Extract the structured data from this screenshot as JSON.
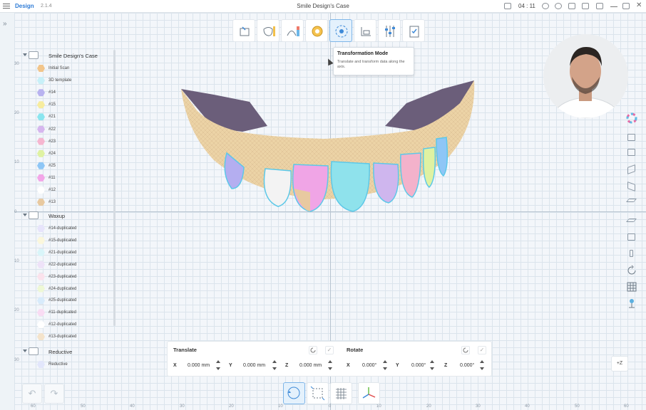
{
  "app": {
    "name": "Design",
    "superscript": "m",
    "version": "2.1.4",
    "doc_title": "Smile Design's Case",
    "recording_time": "04 : 11"
  },
  "toolbar": {
    "tools": [
      {
        "name": "prepare-tool",
        "active": false
      },
      {
        "name": "teeth-library-tool",
        "active": false
      },
      {
        "name": "adapt-tool",
        "active": false
      },
      {
        "name": "design-tool",
        "active": false
      },
      {
        "name": "transformation-mode-tool",
        "active": true
      },
      {
        "name": "base-tool",
        "active": false
      },
      {
        "name": "adjust-tool",
        "active": false
      },
      {
        "name": "finish-tool",
        "active": false
      }
    ]
  },
  "tooltip": {
    "title": "Transformation Mode",
    "description": "Translate and transform data along the axis."
  },
  "tree": {
    "groups": [
      {
        "label": "Smile Design's Case"
      },
      {
        "label": "Waxup"
      },
      {
        "label": "Reductive"
      }
    ],
    "case_items": [
      {
        "label": "Initial Scan",
        "color": "#f2c58a"
      },
      {
        "label": "3D template",
        "color": "#c8f0f8"
      },
      {
        "label": "#14",
        "color": "#b9b3f0"
      },
      {
        "label": "#15",
        "color": "#f7ec9e"
      },
      {
        "label": "#21",
        "color": "#8be5ef"
      },
      {
        "label": "#22",
        "color": "#d6b6ee"
      },
      {
        "label": "#23",
        "color": "#f6b6d0"
      },
      {
        "label": "#24",
        "color": "#dff2a2"
      },
      {
        "label": "#25",
        "color": "#8ec6f6"
      },
      {
        "label": "#11",
        "color": "#f3a6e8"
      },
      {
        "label": "#12",
        "color": "#ffffff"
      },
      {
        "label": "#13",
        "color": "#e8c9a0"
      }
    ],
    "waxup_items": [
      {
        "label": "#14-duplicated",
        "color": "#e7e4fb"
      },
      {
        "label": "#15-duplicated",
        "color": "#fbf7dc"
      },
      {
        "label": "#21-duplicated",
        "color": "#d9f5f9"
      },
      {
        "label": "#22-duplicated",
        "color": "#eee2f8"
      },
      {
        "label": "#23-duplicated",
        "color": "#fbe2ec"
      },
      {
        "label": "#24-duplicated",
        "color": "#eef8d5"
      },
      {
        "label": "#25-duplicated",
        "color": "#d8ebfb"
      },
      {
        "label": "#11-duplicated",
        "color": "#f9dcf3"
      },
      {
        "label": "#12-duplicated",
        "color": "#ffffff"
      },
      {
        "label": "#13-duplicated",
        "color": "#f4e3cb"
      }
    ],
    "reductive_items": [
      {
        "label": "Reductive",
        "color": "#e2e6fb"
      }
    ]
  },
  "transform_panel": {
    "translate_title": "Translate",
    "rotate_title": "Rotate",
    "translate": [
      {
        "axis": "X",
        "value": "0.000 mm"
      },
      {
        "axis": "Y",
        "value": "0.000 mm"
      },
      {
        "axis": "Z",
        "value": "0.000 mm"
      }
    ],
    "rotate": [
      {
        "axis": "X",
        "value": "0.000°"
      },
      {
        "axis": "Y",
        "value": "0.000°"
      },
      {
        "axis": "Z",
        "value": "0.000°"
      }
    ]
  },
  "view": {
    "z_button": "+Z"
  },
  "rulers": {
    "y": [
      "30",
      "20",
      "10",
      "0",
      "10",
      "20",
      "30"
    ],
    "x": [
      "60",
      "50",
      "40",
      "30",
      "20",
      "10",
      "0",
      "10",
      "20",
      "30",
      "40",
      "50",
      "60"
    ]
  }
}
